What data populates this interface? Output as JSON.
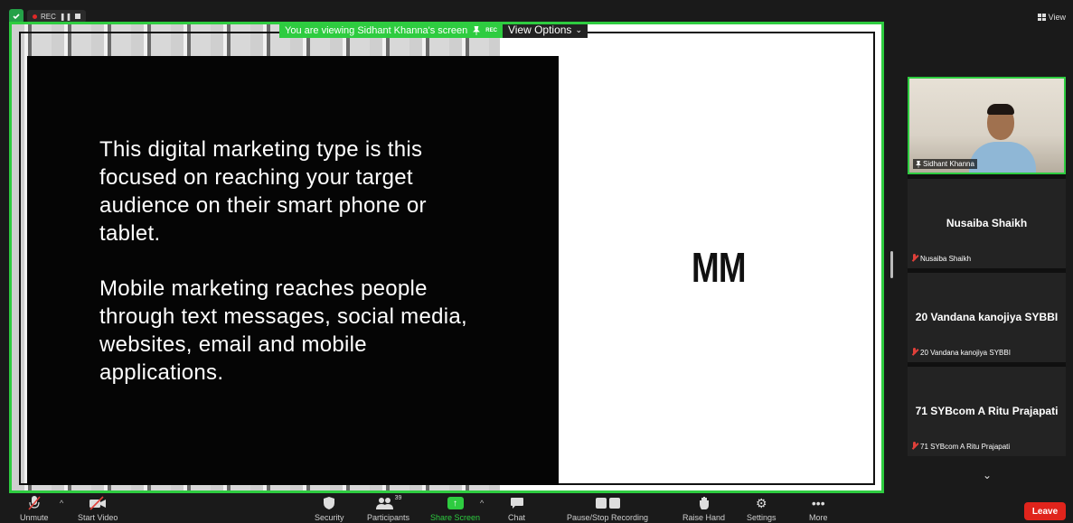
{
  "window": {
    "rec_label": "REC",
    "view_label": "View"
  },
  "share": {
    "banner_text": "You are viewing Sidhant Khanna's screen",
    "banner_rec": "REC",
    "view_options_label": "View Options"
  },
  "slide": {
    "paragraph1": "This digital marketing type is this focused on reaching your target audience on their smart phone or tablet.",
    "paragraph2": "Mobile marketing reaches people through text messages, social media, websites, email and mobile applications.",
    "logo_text": "MM"
  },
  "participants": {
    "video_tile": {
      "name": "Sidhant Khanna"
    },
    "tiles": [
      {
        "big_name": "Nusaiba Shaikh",
        "small_name": "Nusaiba Shaikh"
      },
      {
        "big_name": "20 Vandana kanojiya SYBBI",
        "small_name": "20 Vandana kanojiya SYBBI"
      },
      {
        "big_name": "71 SYBcom A Ritu Prajapati",
        "small_name": "71 SYBcom A Ritu Prajapati"
      }
    ]
  },
  "toolbar": {
    "unmute": "Unmute",
    "start_video": "Start Video",
    "security": "Security",
    "participants": "Participants",
    "participant_count": "39",
    "share_screen": "Share Screen",
    "chat": "Chat",
    "pause_stop_recording": "Pause/Stop Recording",
    "raise_hand": "Raise Hand",
    "settings": "Settings",
    "more": "More",
    "leave": "Leave"
  },
  "colors": {
    "accent_green": "#2ecc40",
    "leave_red": "#e0241c",
    "muted_red": "#e0403a"
  }
}
